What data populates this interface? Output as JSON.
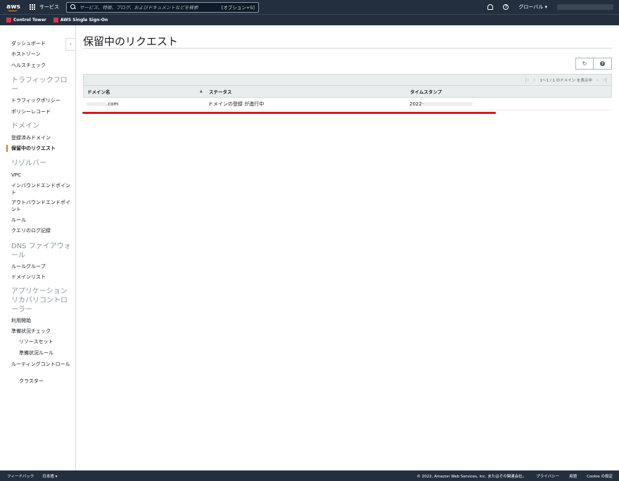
{
  "topnav": {
    "logo": "aws",
    "services_label": "サービス",
    "search_placeholder": "サービス、特徴、ブログ、およびドキュメントなどを検索",
    "search_shortcut": "[オプション+S]",
    "region_label": "グローバル ▾"
  },
  "favorites": [
    {
      "label": "Control Tower"
    },
    {
      "label": "AWS Single Sign-On"
    }
  ],
  "sidebar": {
    "items": [
      {
        "label": "ダッシュボード",
        "type": "item"
      },
      {
        "label": "ホストゾーン",
        "type": "item"
      },
      {
        "label": "ヘルスチェック",
        "type": "item"
      },
      {
        "label": "トラフィックフロー",
        "type": "section"
      },
      {
        "label": "トラフィックポリシー",
        "type": "item"
      },
      {
        "label": "ポリシーレコード",
        "type": "item"
      },
      {
        "label": "ドメイン",
        "type": "section"
      },
      {
        "label": "登録済みドメイン",
        "type": "item"
      },
      {
        "label": "保留中のリクエスト",
        "type": "item",
        "active": true
      },
      {
        "label": "リゾルバー",
        "type": "section"
      },
      {
        "label": "VPC",
        "type": "item"
      },
      {
        "label": "インバウンドエンドポイント",
        "type": "item"
      },
      {
        "label": "アウトバウンドエンドポイント",
        "type": "item"
      },
      {
        "label": "ルール",
        "type": "item"
      },
      {
        "label": "クエリのログ記録",
        "type": "item"
      },
      {
        "label": "DNS ファイアウォール",
        "type": "section"
      },
      {
        "label": "ルールグループ",
        "type": "item"
      },
      {
        "label": "ドメインリスト",
        "type": "item"
      },
      {
        "label": "アプリケーションリカバリコントローラー",
        "type": "section"
      },
      {
        "label": "利用開始",
        "type": "item"
      },
      {
        "label": "準備状況チェック",
        "type": "item"
      },
      {
        "label": "リソースセット",
        "type": "item",
        "indent": true
      },
      {
        "label": "準備状況ルール",
        "type": "item",
        "indent": true
      },
      {
        "label": "ルーティングコントロール",
        "type": "item"
      },
      {
        "label": "クラスター",
        "type": "item",
        "indent": true
      }
    ]
  },
  "main": {
    "title": "保留中のリクエスト",
    "refresh_icon": "↻",
    "pager_text": "1〜1 / 1 のドメイン を表示中",
    "columns": [
      "ドメイン名",
      "ステータス",
      "タイムスタンプ"
    ],
    "rows": [
      {
        "domain": ".com",
        "status": "ドメインの登録 が進行中",
        "timestamp": "2022-"
      }
    ]
  },
  "footer": {
    "feedback": "フィードバック",
    "language": "日本語 ▾",
    "copyright": "© 2022, Amazon Web Services, Inc. またはその関連会社。",
    "privacy": "プライバシー",
    "terms": "用語",
    "cookie": "Cookie の設定"
  }
}
